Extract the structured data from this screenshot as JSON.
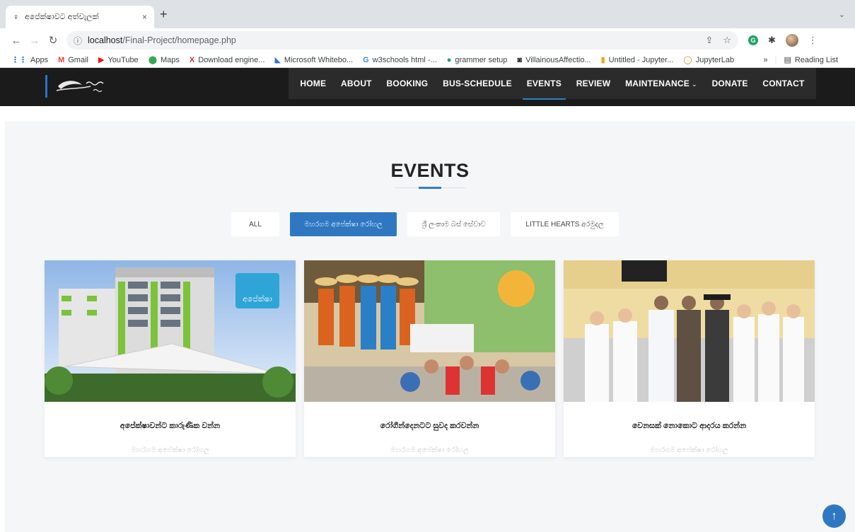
{
  "browser": {
    "tab_title": "අපේක්ෂාවට අත්වැලක්",
    "tab_close": "×",
    "new_tab": "+",
    "url_host": "localhost",
    "url_path": "/Final-Project/homepage.php",
    "bookmarks": [
      {
        "icon": "apps-icon",
        "glyph": "⋮⋮",
        "color": "#1a73e8",
        "label": "Apps"
      },
      {
        "icon": "gmail-icon",
        "glyph": "M",
        "color": "#ea4335",
        "label": "Gmail"
      },
      {
        "icon": "youtube-icon",
        "glyph": "▶",
        "color": "#ff0000",
        "label": "YouTube"
      },
      {
        "icon": "maps-icon",
        "glyph": "⬤",
        "color": "#34a853",
        "label": "Maps"
      },
      {
        "icon": "download-engine-icon",
        "glyph": "X",
        "color": "#d93025",
        "label": "Download engine..."
      },
      {
        "icon": "whiteboard-icon",
        "glyph": "◣",
        "color": "#2b6fd6",
        "label": "Microsoft Whitebo..."
      },
      {
        "icon": "google-icon",
        "glyph": "G",
        "color": "#4285f4",
        "label": "w3schools html -..."
      },
      {
        "icon": "grammer-icon",
        "glyph": "●",
        "color": "#15a35d",
        "label": "grammer setup"
      },
      {
        "icon": "villainous-icon",
        "glyph": "◙",
        "color": "#202124",
        "label": "VillainousAffectio..."
      },
      {
        "icon": "jupyter-untitled-icon",
        "glyph": "▮",
        "color": "#f2a500",
        "label": "Untitled - Jupyter..."
      },
      {
        "icon": "jupyterlab-icon",
        "glyph": "◯",
        "color": "#f37626",
        "label": "JupyterLab"
      }
    ],
    "more_bookmarks": "»",
    "reading_list": "Reading List"
  },
  "header": {
    "nav": [
      {
        "label": "HOME",
        "active": false,
        "dropdown": false
      },
      {
        "label": "ABOUT",
        "active": false,
        "dropdown": false
      },
      {
        "label": "BOOKING",
        "active": false,
        "dropdown": false
      },
      {
        "label": "BUS-SCHEDULE",
        "active": false,
        "dropdown": false
      },
      {
        "label": "EVENTS",
        "active": true,
        "dropdown": false
      },
      {
        "label": "REVIEW",
        "active": false,
        "dropdown": false
      },
      {
        "label": "MAINTENANCE",
        "active": false,
        "dropdown": true
      },
      {
        "label": "DONATE",
        "active": false,
        "dropdown": false
      },
      {
        "label": "CONTACT",
        "active": false,
        "dropdown": false
      }
    ],
    "accent_color": "#2f80c8"
  },
  "events": {
    "title": "EVENTS",
    "filters": [
      {
        "label": "ALL",
        "active": false,
        "width": 48
      },
      {
        "label": "මහරගම අපේක්ෂා රෝහල",
        "active": true,
        "width": 131
      },
      {
        "label": "ශ්‍රී ලංකාම බස් සේවාව",
        "active": false,
        "width": 111
      },
      {
        "label": "LITTLE HEARTS අරමුදල",
        "active": false,
        "width": 133
      }
    ],
    "cards": [
      {
        "title": "අපේක්ෂාවන්ට කාරුණික වන්න",
        "category": "මහරගම අපේක්ෂා රෝහල",
        "image": "hospital-building"
      },
      {
        "title": "රෝගීන්දෙනටට සුවද කරවන්න",
        "category": "මහරගම අපේක්ෂා රෝහල",
        "image": "children-music-event"
      },
      {
        "title": "වෙනසක් නොකොට ආදරය කරන්න",
        "category": "මහරගම අපේක්ෂා රෝහල",
        "image": "nurses-ward-visit"
      }
    ],
    "primary_color": "#2f78c1"
  },
  "back_to_top": "↑"
}
